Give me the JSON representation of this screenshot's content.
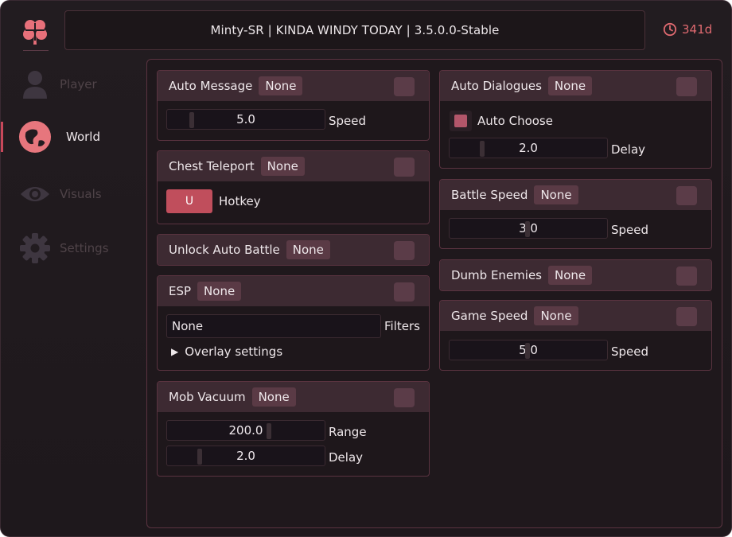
{
  "header": {
    "title": "Minty-SR | KINDA WINDY TODAY | 3.5.0.0-Stable",
    "timer": "341d",
    "logo_icon": "clover-logo",
    "timer_icon": "clock-icon"
  },
  "sidebar": {
    "items": [
      {
        "label": "Player",
        "icon": "person-icon",
        "active": false
      },
      {
        "label": "World",
        "icon": "globe-icon",
        "active": true
      },
      {
        "label": "Visuals",
        "icon": "eye-icon",
        "active": false
      },
      {
        "label": "Settings",
        "icon": "gear-icon",
        "active": false
      }
    ]
  },
  "cards": {
    "auto_message": {
      "title": "Auto Message",
      "key": "None",
      "slider_value": "5.0",
      "slider_label": "Speed"
    },
    "chest_teleport": {
      "title": "Chest Teleport",
      "key": "None",
      "hotkey": "U",
      "hotkey_label": "Hotkey"
    },
    "unlock_auto_battle": {
      "title": "Unlock Auto Battle",
      "key": "None"
    },
    "esp": {
      "title": "ESP",
      "key": "None",
      "filter_value": "None",
      "filter_label": "Filters",
      "overlay_label": "Overlay settings"
    },
    "mob_vacuum": {
      "title": "Mob Vacuum",
      "key": "None",
      "range_value": "200.0",
      "range_label": "Range",
      "delay_value": "2.0",
      "delay_label": "Delay"
    },
    "auto_dialogues": {
      "title": "Auto Dialogues",
      "key": "None",
      "auto_choose_label": "Auto Choose",
      "auto_choose_checked": true,
      "delay_value": "2.0",
      "delay_label": "Delay"
    },
    "battle_speed": {
      "title": "Battle Speed",
      "key": "None",
      "slider_value": "3.0",
      "slider_label": "Speed"
    },
    "dumb_enemies": {
      "title": "Dumb Enemies",
      "key": "None"
    },
    "game_speed": {
      "title": "Game Speed",
      "key": "None",
      "slider_value": "5.0",
      "slider_label": "Speed"
    }
  },
  "colors": {
    "accent": "#c8485a",
    "header_bg": "#3d2a32",
    "chip_bg": "#5a3a45",
    "timer": "#e06a70"
  }
}
